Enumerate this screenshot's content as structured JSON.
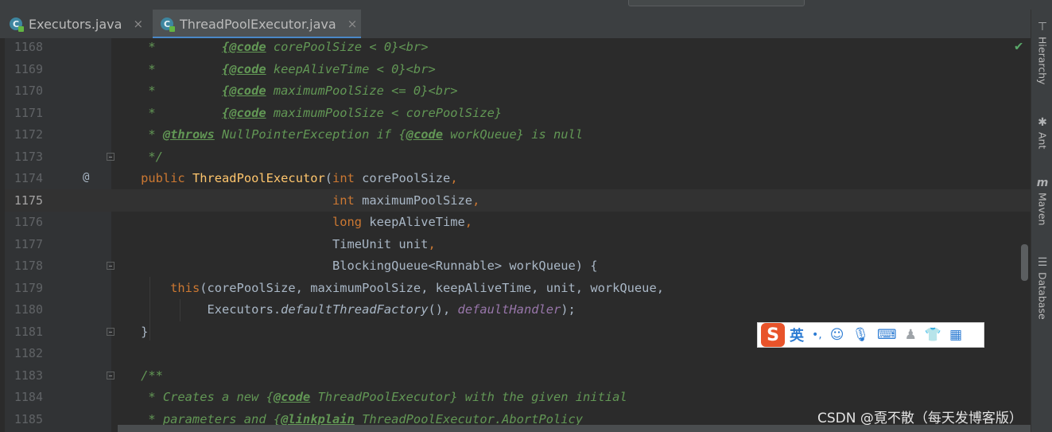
{
  "tabs": [
    {
      "label": "Executors.java",
      "icon": "java-class-icon",
      "active": false
    },
    {
      "label": "ThreadPoolExecutor.java",
      "icon": "java-class-icon",
      "active": true
    }
  ],
  "current_line": "1175",
  "lines": [
    {
      "n": "1168"
    },
    {
      "n": "1169"
    },
    {
      "n": "1170"
    },
    {
      "n": "1171"
    },
    {
      "n": "1172"
    },
    {
      "n": "1173"
    },
    {
      "n": "1174"
    },
    {
      "n": "1175"
    },
    {
      "n": "1176"
    },
    {
      "n": "1177"
    },
    {
      "n": "1178"
    },
    {
      "n": "1179"
    },
    {
      "n": "1180"
    },
    {
      "n": "1181"
    },
    {
      "n": "1182"
    },
    {
      "n": "1183"
    },
    {
      "n": "1184"
    },
    {
      "n": "1185"
    }
  ],
  "code": {
    "l1168": {
      "star": "     *         ",
      "tag": "{@code",
      "rest": " corePoolSize < 0}<br>"
    },
    "l1169": {
      "star": "     *         ",
      "tag": "{@code",
      "rest": " keepAliveTime < 0}<br>"
    },
    "l1170": {
      "star": "     *         ",
      "tag": "{@code",
      "rest": " maximumPoolSize <= 0}<br>"
    },
    "l1171": {
      "star": "     *         ",
      "tag": "{@code",
      "rest": " maximumPoolSize < corePoolSize}"
    },
    "l1172": {
      "star": "     * ",
      "tag1": "@throws",
      "mid": " NullPointerException if {",
      "tag2": "@code",
      "rest": " workQueue} is null"
    },
    "l1173": {
      "text": "     */"
    },
    "l1174": {
      "indent": "    ",
      "kw1": "public",
      "sp": " ",
      "fn": "ThreadPoolExecutor",
      "p1": "(",
      "kw2": "int",
      "rest": " corePoolSize",
      "comma": ","
    },
    "l1175": {
      "indent": "                              ",
      "kw": "int",
      "rest": " maximumPoolSize",
      "comma": ","
    },
    "l1176": {
      "indent": "                              ",
      "kw": "long",
      "rest": " keepAliveTime",
      "comma": ","
    },
    "l1177": {
      "indent": "                              ",
      "rest": "TimeUnit unit",
      "comma": ","
    },
    "l1178": {
      "indent": "                              ",
      "rest": "BlockingQueue<Runnable> workQueue) {"
    },
    "l1179": {
      "indent": "        ",
      "kw": "this",
      "rest": "(corePoolSize, maximumPoolSize, keepAliveTime, unit, workQueue,"
    },
    "l1180": {
      "indent": "             ",
      "a": "Executors.",
      "it": "defaultThreadFactory",
      "b": "(), ",
      "fld": "defaultHandler",
      "c": ");"
    },
    "l1181": {
      "text": "    }"
    },
    "l1183": {
      "text": "    /**"
    },
    "l1184": {
      "pre": "     * Creates a new {",
      "tag": "@code",
      "post": " ThreadPoolExecutor} with the given initial"
    },
    "l1185": {
      "pre": "     * parameters and {",
      "tag": "@linkplain",
      "post": " ThreadPoolExecutor.AbortPolicy"
    }
  },
  "gutter": {
    "override_marker": "@"
  },
  "sidebar": [
    {
      "label": "Hierarchy",
      "icon": "hierarchy-icon"
    },
    {
      "label": "Ant",
      "icon": "ant-icon"
    },
    {
      "label": "Maven",
      "icon": "maven-icon"
    },
    {
      "label": "Database",
      "icon": "database-icon"
    }
  ],
  "ime": {
    "logo": "S",
    "mode": "英",
    "punct": "•,"
  },
  "watermark": "CSDN @覔不散（每天发博客版）",
  "colors": {
    "background": "#2b2b2b",
    "keyword": "#cc7832",
    "method": "#ffc66d",
    "doc": "#629755",
    "field": "#9876aa",
    "tab_accent": "#4a88c7"
  }
}
